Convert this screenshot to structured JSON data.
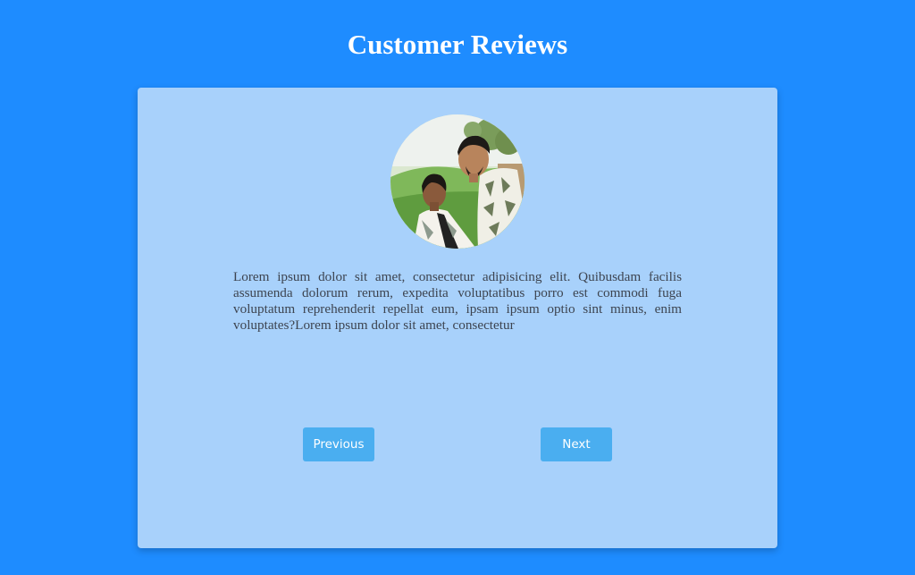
{
  "header": {
    "title": "Customer Reviews"
  },
  "review": {
    "avatar_icon": "reviewer-photo",
    "text": "Lorem ipsum dolor sit amet, consectetur adipisicing elit. Quibusdam facilis assumenda dolorum rerum, expedita voluptatibus porro est commodi fuga voluptatum reprehenderit repellat eum, ipsam ipsum optio sint minus, enim voluptates?Lorem ipsum dolor sit amet, consectetur"
  },
  "navigation": {
    "previous_label": "Previous",
    "next_label": "Next"
  },
  "colors": {
    "page_background": "#1e8cff",
    "card_background": "#a8d1fb",
    "button_background": "#4aaef0",
    "title_color": "#ffffff",
    "text_color": "#3d4450"
  }
}
